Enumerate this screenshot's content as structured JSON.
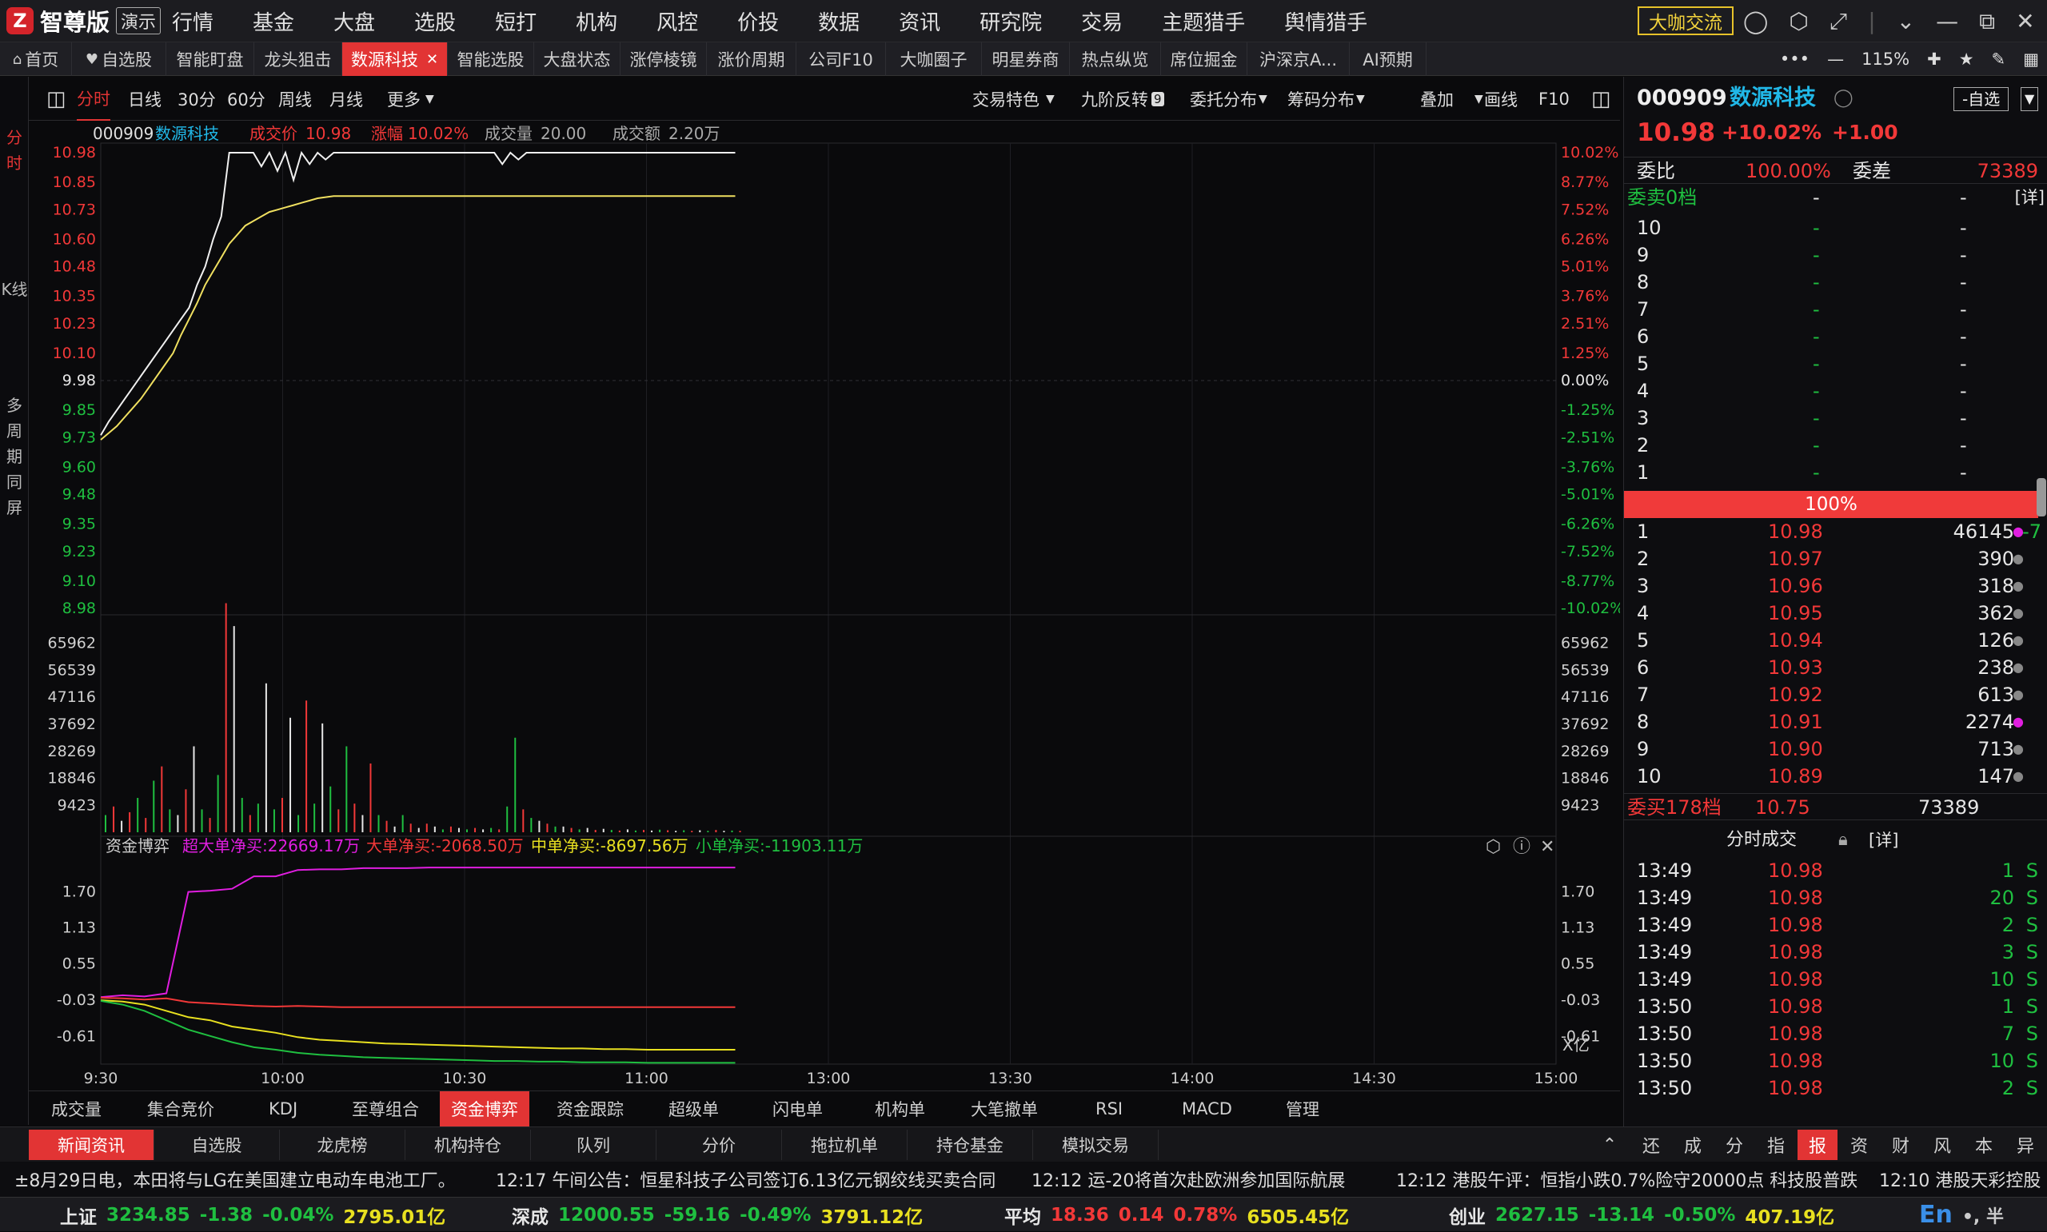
{
  "app": {
    "brand": "智尊版",
    "demo": "演示",
    "logo_char": "Z"
  },
  "menu": [
    "行情",
    "基金",
    "大盘",
    "选股",
    "短打",
    "机构",
    "风控",
    "价投",
    "数据",
    "资讯",
    "研究院",
    "交易",
    "主题猎手",
    "舆情猎手"
  ],
  "exchange_btn": "大咖交流",
  "tabs": [
    {
      "label": "首页",
      "icon": "home-icon"
    },
    {
      "label": "自选股",
      "icon": "heart-icon"
    },
    {
      "label": "智能盯盘"
    },
    {
      "label": "龙头狙击"
    },
    {
      "label": "数源科技",
      "active": true
    },
    {
      "label": "智能选股"
    },
    {
      "label": "大盘状态"
    },
    {
      "label": "涨停棱镜"
    },
    {
      "label": "涨价周期"
    },
    {
      "label": "公司F10"
    },
    {
      "label": "大咖圈子"
    },
    {
      "label": "明星券商"
    },
    {
      "label": "热点纵览"
    },
    {
      "label": "席位掘金"
    },
    {
      "label": "沪深京A..."
    },
    {
      "label": "AI预期"
    }
  ],
  "zoom": "115%",
  "left_tabs": [
    "分时",
    "K线",
    "多周期同屏"
  ],
  "periods": [
    "分时",
    "日线",
    "30分",
    "60分",
    "周线",
    "月线",
    "更多"
  ],
  "toolbar_right": [
    "交易特色",
    "九阶反转",
    "委托分布",
    "筹码分布",
    "叠加",
    "画线",
    "F10"
  ],
  "nine_badge": "9",
  "chart_header": {
    "code": "000909",
    "name": "数源科技",
    "price_label": "成交价",
    "price": "10.98",
    "chg_label": "涨幅",
    "chg": "10.02%",
    "vol_label": "成交量",
    "vol": "20.00",
    "amt_label": "成交额",
    "amt": "2.20万"
  },
  "chart_data": {
    "type": "line",
    "x": [
      "9:30",
      "10:00",
      "10:30",
      "11:00",
      "13:00",
      "13:30",
      "14:00",
      "14:30",
      "15:00"
    ],
    "price_ticks": [
      "10.98",
      "10.85",
      "10.73",
      "10.60",
      "10.48",
      "10.35",
      "10.23",
      "10.10",
      "9.98",
      "9.85",
      "9.73",
      "9.60",
      "9.48",
      "9.35",
      "9.23",
      "9.10",
      "8.98"
    ],
    "pct_ticks": [
      "10.02%",
      "8.77%",
      "7.52%",
      "6.26%",
      "5.01%",
      "3.76%",
      "2.51%",
      "1.25%",
      "0.00%",
      "-1.25%",
      "-2.51%",
      "-3.76%",
      "-5.01%",
      "-6.26%",
      "-7.52%",
      "-8.77%",
      "-10.02%"
    ],
    "vol_ticks": [
      "65962",
      "56539",
      "47116",
      "37692",
      "28269",
      "18846",
      "9423"
    ],
    "flow_ticks": [
      "1.70",
      "1.13",
      "0.55",
      "-0.03",
      "-0.61"
    ],
    "flow_unit": "X亿",
    "price_series": [
      9.74,
      9.8,
      9.85,
      9.9,
      9.95,
      10.0,
      10.05,
      10.1,
      10.15,
      10.2,
      10.25,
      10.3,
      10.4,
      10.48,
      10.6,
      10.7,
      10.98,
      10.98,
      10.98,
      10.98,
      10.92,
      10.98,
      10.9,
      10.98,
      10.86,
      10.98,
      10.93,
      10.98,
      10.95,
      10.98,
      10.98,
      10.98,
      10.98,
      10.98,
      10.98,
      10.98,
      10.98,
      10.98,
      10.98,
      10.98,
      10.98,
      10.98,
      10.98,
      10.98,
      10.98,
      10.98,
      10.98,
      10.98,
      10.98,
      10.98,
      10.93,
      10.98,
      10.95,
      10.98,
      10.98,
      10.98,
      10.98,
      10.98,
      10.98,
      10.98,
      10.98,
      10.98,
      10.98,
      10.98,
      10.98,
      10.98,
      10.98,
      10.98,
      10.98,
      10.98,
      10.98,
      10.98,
      10.98,
      10.98,
      10.98,
      10.98,
      10.98,
      10.98,
      10.98,
      10.98
    ],
    "avg_series": [
      9.72,
      9.75,
      9.78,
      9.82,
      9.86,
      9.9,
      9.95,
      10.0,
      10.05,
      10.1,
      10.18,
      10.25,
      10.32,
      10.4,
      10.46,
      10.52,
      10.58,
      10.62,
      10.66,
      10.68,
      10.7,
      10.72,
      10.73,
      10.74,
      10.75,
      10.76,
      10.77,
      10.78,
      10.785,
      10.79,
      10.79,
      10.79,
      10.79,
      10.79,
      10.79,
      10.79,
      10.79,
      10.79,
      10.79,
      10.79,
      10.79,
      10.79,
      10.79,
      10.79,
      10.79,
      10.79,
      10.79,
      10.79,
      10.79,
      10.79,
      10.79,
      10.79,
      10.79,
      10.79,
      10.79,
      10.79,
      10.79,
      10.79,
      10.79,
      10.79,
      10.79,
      10.79,
      10.79,
      10.79,
      10.79,
      10.79,
      10.79,
      10.79,
      10.79,
      10.79,
      10.79,
      10.79,
      10.79,
      10.79,
      10.79,
      10.79,
      10.79,
      10.79,
      10.79,
      10.79
    ],
    "volume_series": [
      6000,
      9000,
      4000,
      7000,
      12000,
      5000,
      18000,
      23000,
      8000,
      6000,
      15000,
      30000,
      8000,
      5000,
      20000,
      80000,
      72000,
      12000,
      6000,
      10000,
      52000,
      8000,
      12000,
      40000,
      6000,
      46000,
      10000,
      38000,
      16000,
      8000,
      30000,
      10000,
      6000,
      24000,
      6000,
      4000,
      2000,
      6000,
      3000,
      1500,
      3000,
      2000,
      1000,
      2000,
      1500,
      1000,
      1500,
      1000,
      1500,
      1000,
      9000,
      33000,
      8000,
      5000,
      4000,
      3000,
      2000,
      2000,
      1500,
      1000,
      1500,
      800,
      1200,
      800,
      600,
      1000,
      600,
      800,
      600,
      900,
      700,
      500,
      700,
      500,
      700,
      500,
      800,
      500,
      600,
      500
    ],
    "volume_colors": [
      "g",
      "r",
      "w",
      "r",
      "g",
      "r",
      "g",
      "r",
      "g",
      "w",
      "r",
      "w",
      "g",
      "r",
      "g",
      "r",
      "w",
      "g",
      "r",
      "g",
      "w",
      "g",
      "r",
      "w",
      "g",
      "r",
      "g",
      "w",
      "g",
      "r",
      "g",
      "r",
      "w",
      "r",
      "g",
      "r",
      "w",
      "g",
      "r",
      "w",
      "r",
      "w",
      "g",
      "r",
      "w",
      "g",
      "r",
      "w",
      "g",
      "r",
      "g",
      "g",
      "r",
      "g",
      "w",
      "r",
      "g",
      "w",
      "r",
      "g",
      "w",
      "r",
      "w",
      "g",
      "r",
      "w",
      "g",
      "r",
      "w",
      "g",
      "r",
      "w",
      "g",
      "r",
      "w",
      "g",
      "r",
      "w",
      "g",
      "r"
    ],
    "flow_super": [
      0.02,
      0.05,
      0.03,
      0.08,
      1.7,
      1.72,
      1.75,
      1.95,
      1.95,
      2.05,
      2.06,
      2.06,
      2.08,
      2.08,
      2.08,
      2.09,
      2.09,
      2.09,
      2.09,
      2.09,
      2.09,
      2.09,
      2.09,
      2.09,
      2.09,
      2.09,
      2.09,
      2.09,
      2.09,
      2.09
    ],
    "flow_big": [
      0.01,
      0.0,
      -0.02,
      0.0,
      -0.06,
      -0.08,
      -0.1,
      -0.12,
      -0.13,
      -0.12,
      -0.13,
      -0.14,
      -0.14,
      -0.14,
      -0.14,
      -0.14,
      -0.14,
      -0.14,
      -0.14,
      -0.14,
      -0.14,
      -0.14,
      -0.14,
      -0.14,
      -0.14,
      -0.14,
      -0.14,
      -0.14,
      -0.14,
      -0.14
    ],
    "flow_mid": [
      -0.03,
      -0.05,
      -0.1,
      -0.2,
      -0.3,
      -0.35,
      -0.45,
      -0.5,
      -0.55,
      -0.62,
      -0.66,
      -0.68,
      -0.7,
      -0.72,
      -0.73,
      -0.74,
      -0.75,
      -0.76,
      -0.77,
      -0.78,
      -0.79,
      -0.8,
      -0.8,
      -0.81,
      -0.81,
      -0.82,
      -0.82,
      -0.82,
      -0.82,
      -0.82
    ],
    "flow_small": [
      -0.04,
      -0.1,
      -0.2,
      -0.35,
      -0.5,
      -0.6,
      -0.7,
      -0.78,
      -0.82,
      -0.87,
      -0.9,
      -0.92,
      -0.94,
      -0.95,
      -0.96,
      -0.97,
      -0.98,
      -0.99,
      -1.0,
      -1.0,
      -1.01,
      -1.01,
      -1.02,
      -1.02,
      -1.02,
      -1.03,
      -1.03,
      -1.03,
      -1.03,
      -1.03
    ]
  },
  "flow_panel": {
    "title": "资金博弈",
    "super": "超大单净买:22669.17万",
    "big": "大单净买:-2068.50万",
    "mid": "中单净买:-8697.56万",
    "small": "小单净买:-11903.11万"
  },
  "bottom_tabs": [
    "成交量",
    "集合竞价",
    "KDJ",
    "至尊组合",
    "资金博弈",
    "资金跟踪",
    "超级单",
    "闪电单",
    "机构单",
    "大笔撤单",
    "RSI",
    "MACD",
    "管理"
  ],
  "news_tabs": [
    "新闻资讯",
    "自选股",
    "龙虎榜",
    "机构持仓",
    "队列",
    "分价",
    "拖拉机单",
    "持仓基金",
    "模拟交易"
  ],
  "news_right_tabs": [
    "还",
    "成",
    "分",
    "指",
    "报",
    "资",
    "财",
    "风",
    "本",
    "异"
  ],
  "news": [
    {
      "text": "±8月29日电，本田将与LG在美国建立电动车电池工厂。"
    },
    {
      "text": "12:17 午间公告：恒星科技子公司签订6.13亿元钢绞线买卖合同"
    },
    {
      "text": "12:12 运-20将首次赴欧洲参加国际航展"
    },
    {
      "text": "12:12 港股午评：恒指小跌0.7%险守20000点 科技股普跌"
    },
    {
      "text": "12:10 港股天彩控股"
    }
  ],
  "status": [
    {
      "name": "上证",
      "price": "3234.85",
      "chg": "-1.38",
      "pct": "-0.04%",
      "amt": "2795.01亿"
    },
    {
      "name": "深成",
      "price": "12000.55",
      "chg": "-59.16",
      "pct": "-0.49%",
      "amt": "3791.12亿"
    },
    {
      "name": "平均",
      "price": "18.36",
      "chg": "0.14",
      "pct": "0.78%",
      "amt": "6505.45亿"
    },
    {
      "name": "创业",
      "price": "2627.15",
      "chg": "-13.14",
      "pct": "-0.50%",
      "amt": "407.19亿"
    }
  ],
  "ime": "En",
  "quote": {
    "code": "000909",
    "name": "数源科技",
    "add_btn": "-自选",
    "price": "10.98",
    "pct": "+10.02%",
    "chg": "+1.00",
    "wb_label": "委比",
    "wb": "100.00%",
    "wc_label": "委差",
    "wc": "73389",
    "sell_head": "委卖0档",
    "dash": "-",
    "detail": "[详]",
    "sell_levels": [
      "10",
      "9",
      "8",
      "7",
      "6",
      "5",
      "4",
      "3",
      "2",
      "1"
    ],
    "bar_pct": "100%",
    "buy_levels": [
      {
        "n": "1",
        "p": "10.98",
        "v": "46145",
        "x": "-7",
        "dot": "m"
      },
      {
        "n": "2",
        "p": "10.97",
        "v": "390",
        "dot": "g"
      },
      {
        "n": "3",
        "p": "10.96",
        "v": "318",
        "dot": "g"
      },
      {
        "n": "4",
        "p": "10.95",
        "v": "362",
        "dot": "g"
      },
      {
        "n": "5",
        "p": "10.94",
        "v": "126",
        "dot": "g"
      },
      {
        "n": "6",
        "p": "10.93",
        "v": "238",
        "dot": "g"
      },
      {
        "n": "7",
        "p": "10.92",
        "v": "613",
        "dot": "g"
      },
      {
        "n": "8",
        "p": "10.91",
        "v": "2274",
        "dot": "m"
      },
      {
        "n": "9",
        "p": "10.90",
        "v": "713",
        "dot": "g"
      },
      {
        "n": "10",
        "p": "10.89",
        "v": "147",
        "dot": "g"
      }
    ],
    "buy_foot": {
      "label": "委买178档",
      "p": "10.75",
      "v": "73389"
    },
    "ticks_title": "分时成交",
    "ticks_detail": "[详]",
    "ticks": [
      {
        "t": "13:49",
        "p": "10.98",
        "v": "1",
        "s": "S"
      },
      {
        "t": "13:49",
        "p": "10.98",
        "v": "20",
        "s": "S"
      },
      {
        "t": "13:49",
        "p": "10.98",
        "v": "2",
        "s": "S"
      },
      {
        "t": "13:49",
        "p": "10.98",
        "v": "3",
        "s": "S"
      },
      {
        "t": "13:49",
        "p": "10.98",
        "v": "10",
        "s": "S"
      },
      {
        "t": "13:50",
        "p": "10.98",
        "v": "1",
        "s": "S"
      },
      {
        "t": "13:50",
        "p": "10.98",
        "v": "7",
        "s": "S"
      },
      {
        "t": "13:50",
        "p": "10.98",
        "v": "10",
        "s": "S"
      },
      {
        "t": "13:50",
        "p": "10.98",
        "v": "2",
        "s": "S"
      }
    ]
  }
}
